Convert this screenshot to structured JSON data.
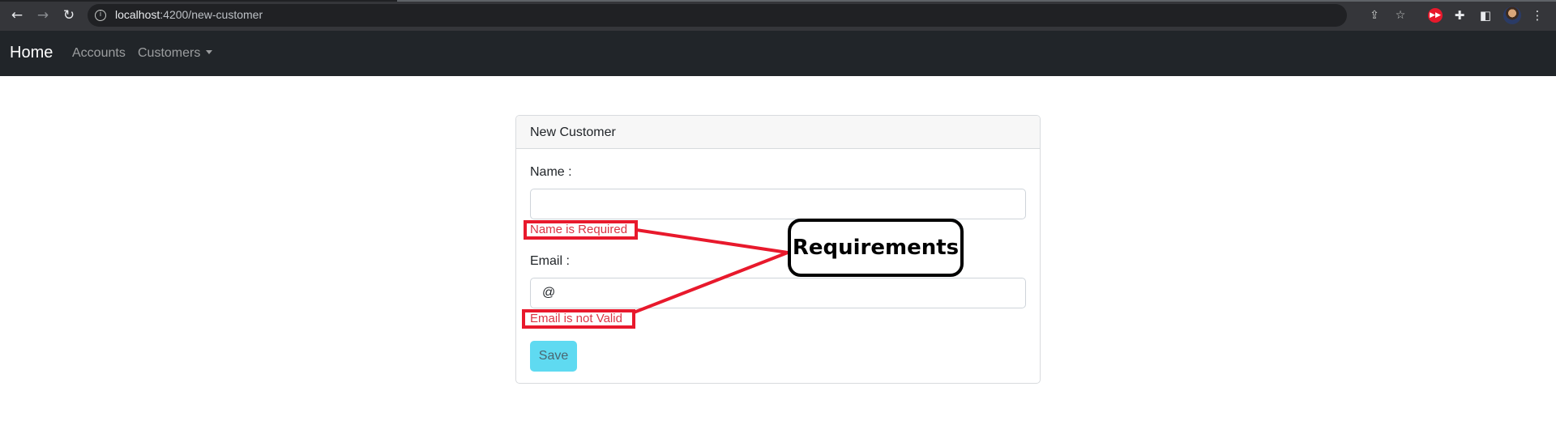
{
  "browser": {
    "url_host": "localhost",
    "url_path": ":4200/new-customer",
    "nav": {
      "back": "←",
      "forward": "→",
      "reload": "↻"
    },
    "icons": [
      "info-icon",
      "share-icon",
      "star-icon",
      "extension-red-icon",
      "puzzle-icon",
      "sidepanel-icon",
      "profile-avatar",
      "menu-kebab-icon"
    ]
  },
  "navbar": {
    "brand": "Home",
    "links": [
      "Accounts",
      "Customers"
    ]
  },
  "form": {
    "title": "New Customer",
    "name_label": "Name :",
    "name_value": "",
    "name_error": "Name is Required",
    "email_label": "Email :",
    "email_value": "@",
    "email_error": "Email is not Valid",
    "save_label": "Save"
  },
  "annotation": {
    "callout": "Requirements"
  },
  "colors": {
    "navbar_bg": "#212529",
    "error_text": "#dc3545",
    "save_button": "#5fdaf1",
    "annotation_red": "#e8192c"
  }
}
